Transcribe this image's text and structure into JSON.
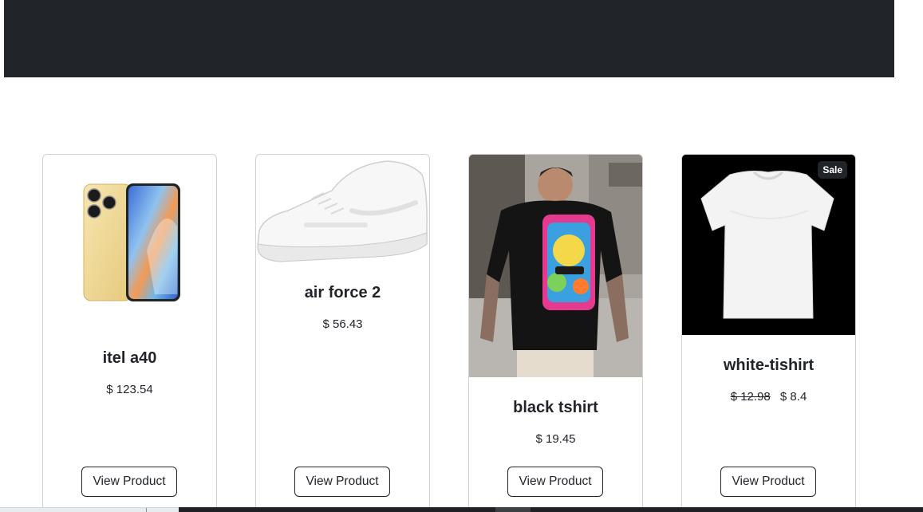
{
  "products": [
    {
      "title": "itel a40",
      "price": "$ 123.54",
      "button": "View Product"
    },
    {
      "title": "air force 2",
      "price": "$ 56.43",
      "button": "View Product"
    },
    {
      "title": "black tshirt",
      "price": "$ 19.45",
      "button": "View Product"
    },
    {
      "title": "white-tishirt",
      "old_price": "$ 12.98",
      "price": "$ 8.4",
      "badge": "Sale",
      "button": "View Product"
    }
  ],
  "colors": {
    "dark": "#212529",
    "border": "#d3d3d3",
    "background": "#ffffff"
  }
}
